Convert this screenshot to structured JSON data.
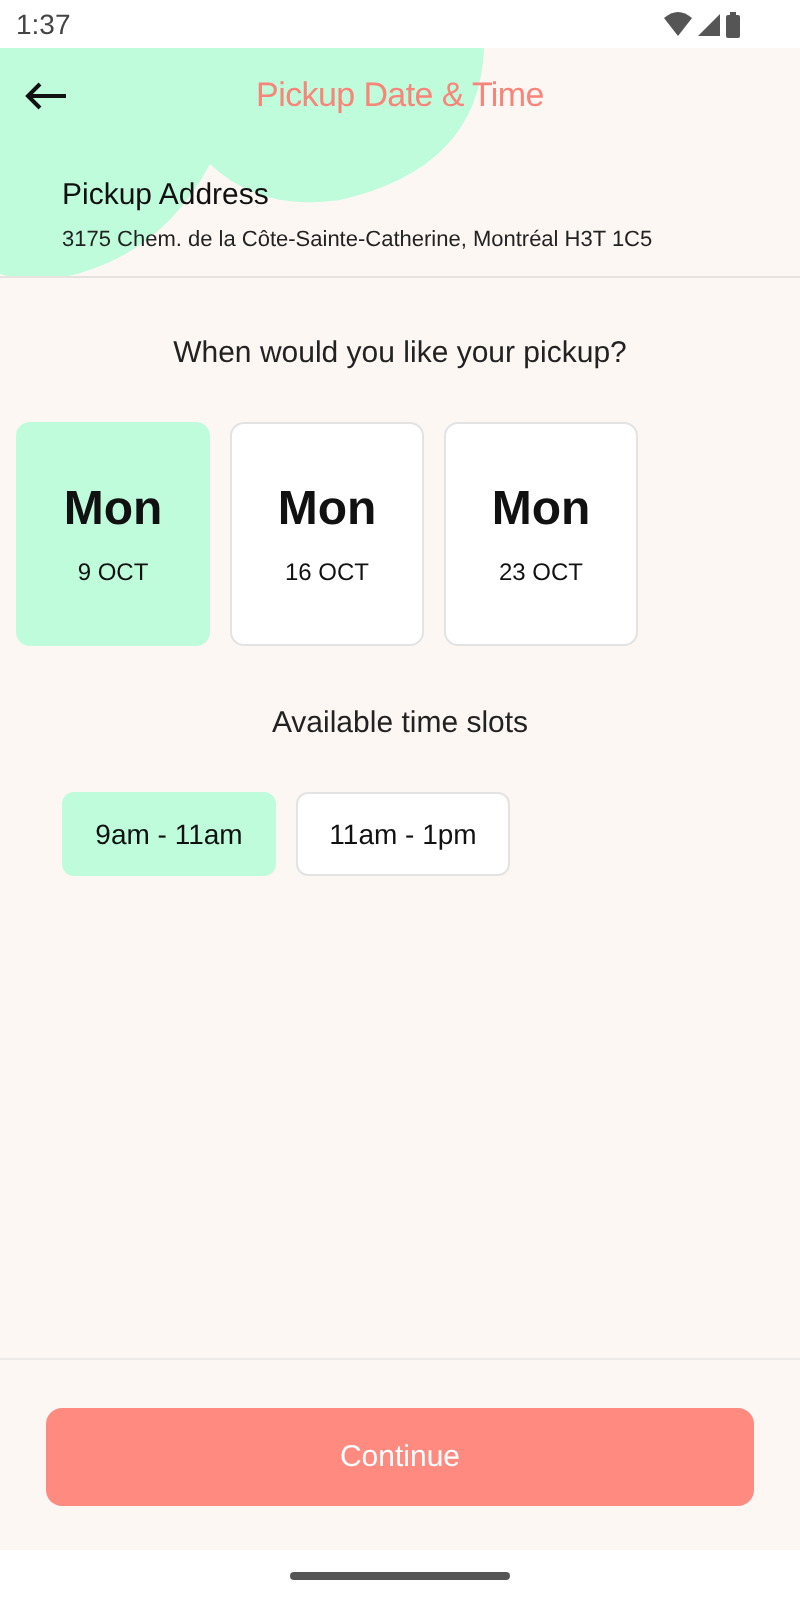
{
  "status_bar": {
    "time": "1:37"
  },
  "header": {
    "title": "Pickup Date & Time"
  },
  "address": {
    "label": "Pickup Address",
    "value": "3175 Chem. de la Côte-Sainte-Catherine, Montréal H3T 1C5"
  },
  "date_prompt": "When would you like your pickup?",
  "dates": [
    {
      "day": "Mon",
      "date": "9 OCT",
      "selected": true
    },
    {
      "day": "Mon",
      "date": "16 OCT",
      "selected": false
    },
    {
      "day": "Mon",
      "date": "23 OCT",
      "selected": false
    }
  ],
  "slots_label": "Available time slots",
  "slots": [
    {
      "label": "9am - 11am",
      "selected": true
    },
    {
      "label": "11am - 1pm",
      "selected": false
    }
  ],
  "continue_button": "Continue"
}
